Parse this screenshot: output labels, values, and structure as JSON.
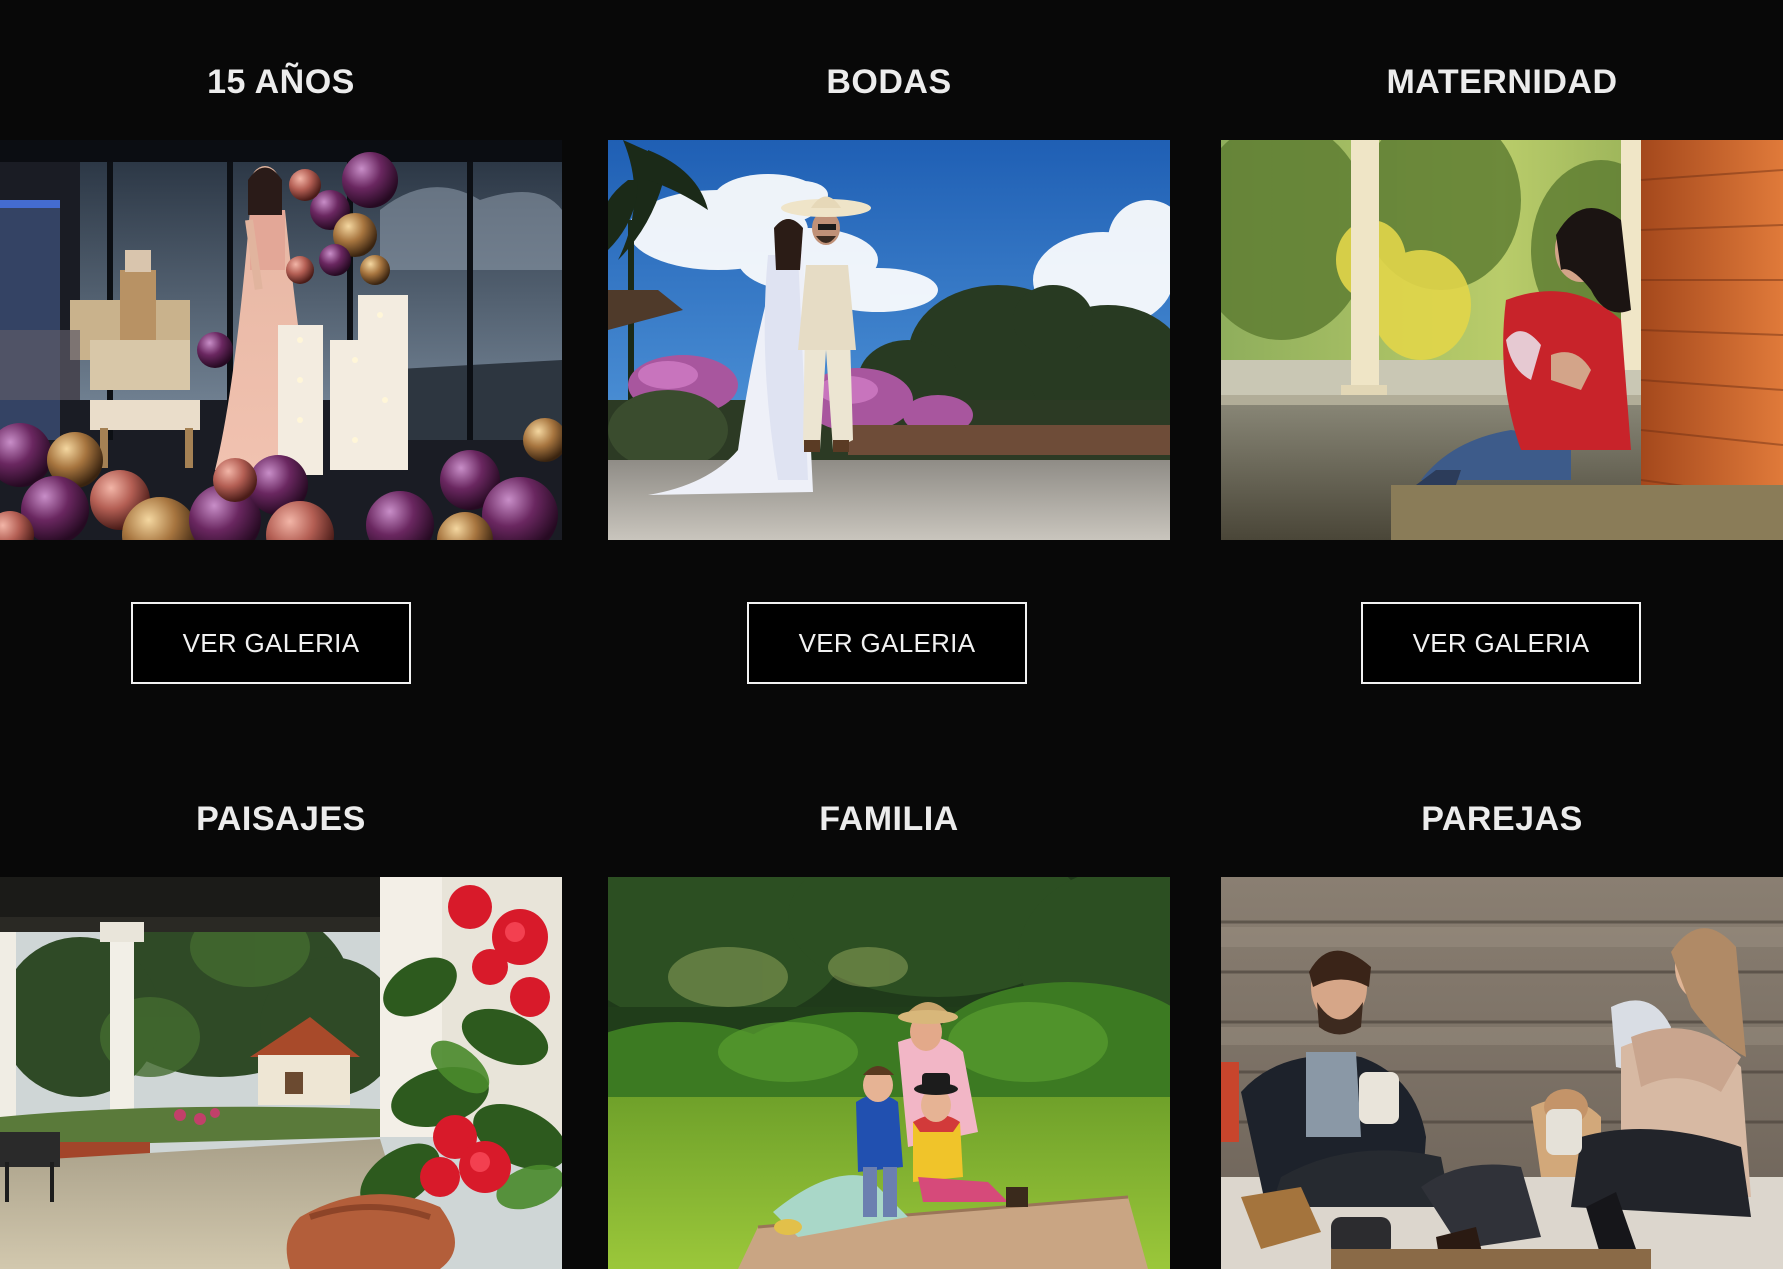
{
  "colors": {
    "background": "#080808",
    "title": "#ececec",
    "button_border": "#f2f2f2"
  },
  "categories": [
    {
      "title": "15 AÑOS",
      "button_label": "VER GALERIA",
      "image": "quinceanera-photo"
    },
    {
      "title": "BODAS",
      "button_label": "VER GALERIA",
      "image": "wedding-photo"
    },
    {
      "title": "MATERNIDAD",
      "button_label": "VER GALERIA",
      "image": "maternity-photo"
    },
    {
      "title": "PAISAJES",
      "image": "landscape-photo"
    },
    {
      "title": "FAMILIA",
      "image": "family-photo"
    },
    {
      "title": "PAREJAS",
      "image": "couple-photo"
    }
  ]
}
